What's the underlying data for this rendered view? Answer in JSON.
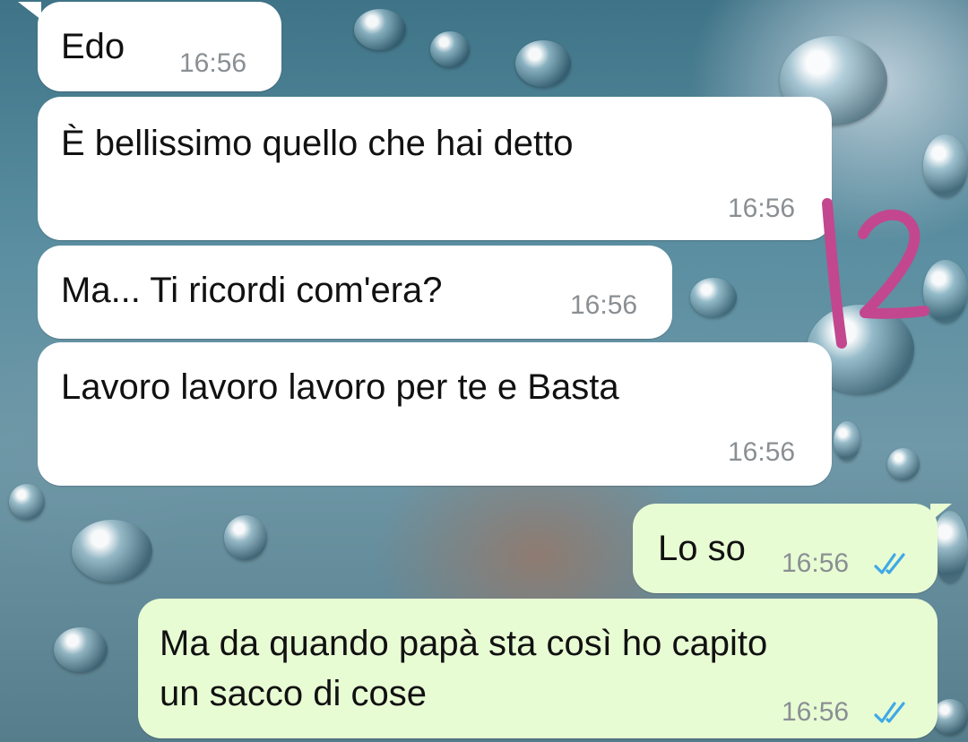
{
  "theme": {
    "incoming_bubble": "#ffffff",
    "outgoing_bubble": "#e8fcd4",
    "timestamp_color": "#8a8f93",
    "read_ticks_color": "#3fa9e5",
    "annotation_color": "#c2478f"
  },
  "messages": [
    {
      "text": "Edo",
      "time": "16:56",
      "direction": "incoming"
    },
    {
      "text": "È bellissimo quello che hai detto",
      "time": "16:56",
      "direction": "incoming"
    },
    {
      "text": "Ma... Ti ricordi com'era?",
      "time": "16:56",
      "direction": "incoming"
    },
    {
      "text": "Lavoro lavoro lavoro per te e Basta",
      "time": "16:56",
      "direction": "incoming"
    },
    {
      "text": "Lo so",
      "time": "16:56",
      "direction": "outgoing",
      "status_icon": "double-check-read-icon"
    },
    {
      "text": "Ma da quando papà sta così ho capito\nun sacco di cose",
      "time": "16:56",
      "direction": "outgoing",
      "status_icon": "double-check-read-icon"
    }
  ],
  "annotation": {
    "text": "12"
  }
}
